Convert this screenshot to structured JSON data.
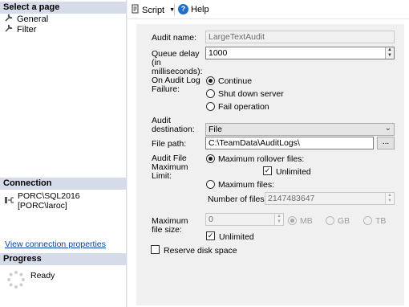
{
  "left": {
    "select_page_header": "Select a page",
    "pages": [
      {
        "label": "General",
        "icon": "wrench-icon"
      },
      {
        "label": "Filter",
        "icon": "wrench-icon"
      }
    ],
    "connection_header": "Connection",
    "connection_text": "PORC\\SQL2016 [PORC\\laroc]",
    "view_connection_link": "View connection properties",
    "progress_header": "Progress",
    "progress_status": "Ready"
  },
  "toolbar": {
    "script_label": "Script",
    "help_label": "Help"
  },
  "form": {
    "audit_name_label": "Audit name:",
    "audit_name_value": "LargeTextAudit",
    "queue_delay_label": "Queue delay (in milliseconds):",
    "queue_delay_value": "1000",
    "on_failure_label": "On Audit Log Failure:",
    "on_failure_options": [
      "Continue",
      "Shut down server",
      "Fail operation"
    ],
    "destination_label": "Audit destination:",
    "destination_value": "File",
    "file_path_label": "File path:",
    "file_path_value": "C:\\TeamData\\AuditLogs\\",
    "browse_label": "...",
    "max_limit_label": "Audit File Maximum Limit:",
    "max_rollover_label": "Maximum rollover files:",
    "unlimited_label": "Unlimited",
    "max_files_label": "Maximum files:",
    "number_of_files_label": "Number of files:",
    "number_of_files_value": "2147483647",
    "max_file_size_label": "Maximum file size:",
    "max_file_size_value": "0",
    "unit_mb": "MB",
    "unit_gb": "GB",
    "unit_tb": "TB",
    "size_unlimited_label": "Unlimited",
    "reserve_disk_label": "Reserve disk space"
  },
  "colors": {
    "section_header": "#d6dbe9",
    "form_background": "#f0f0f0",
    "link": "#0645ad"
  }
}
